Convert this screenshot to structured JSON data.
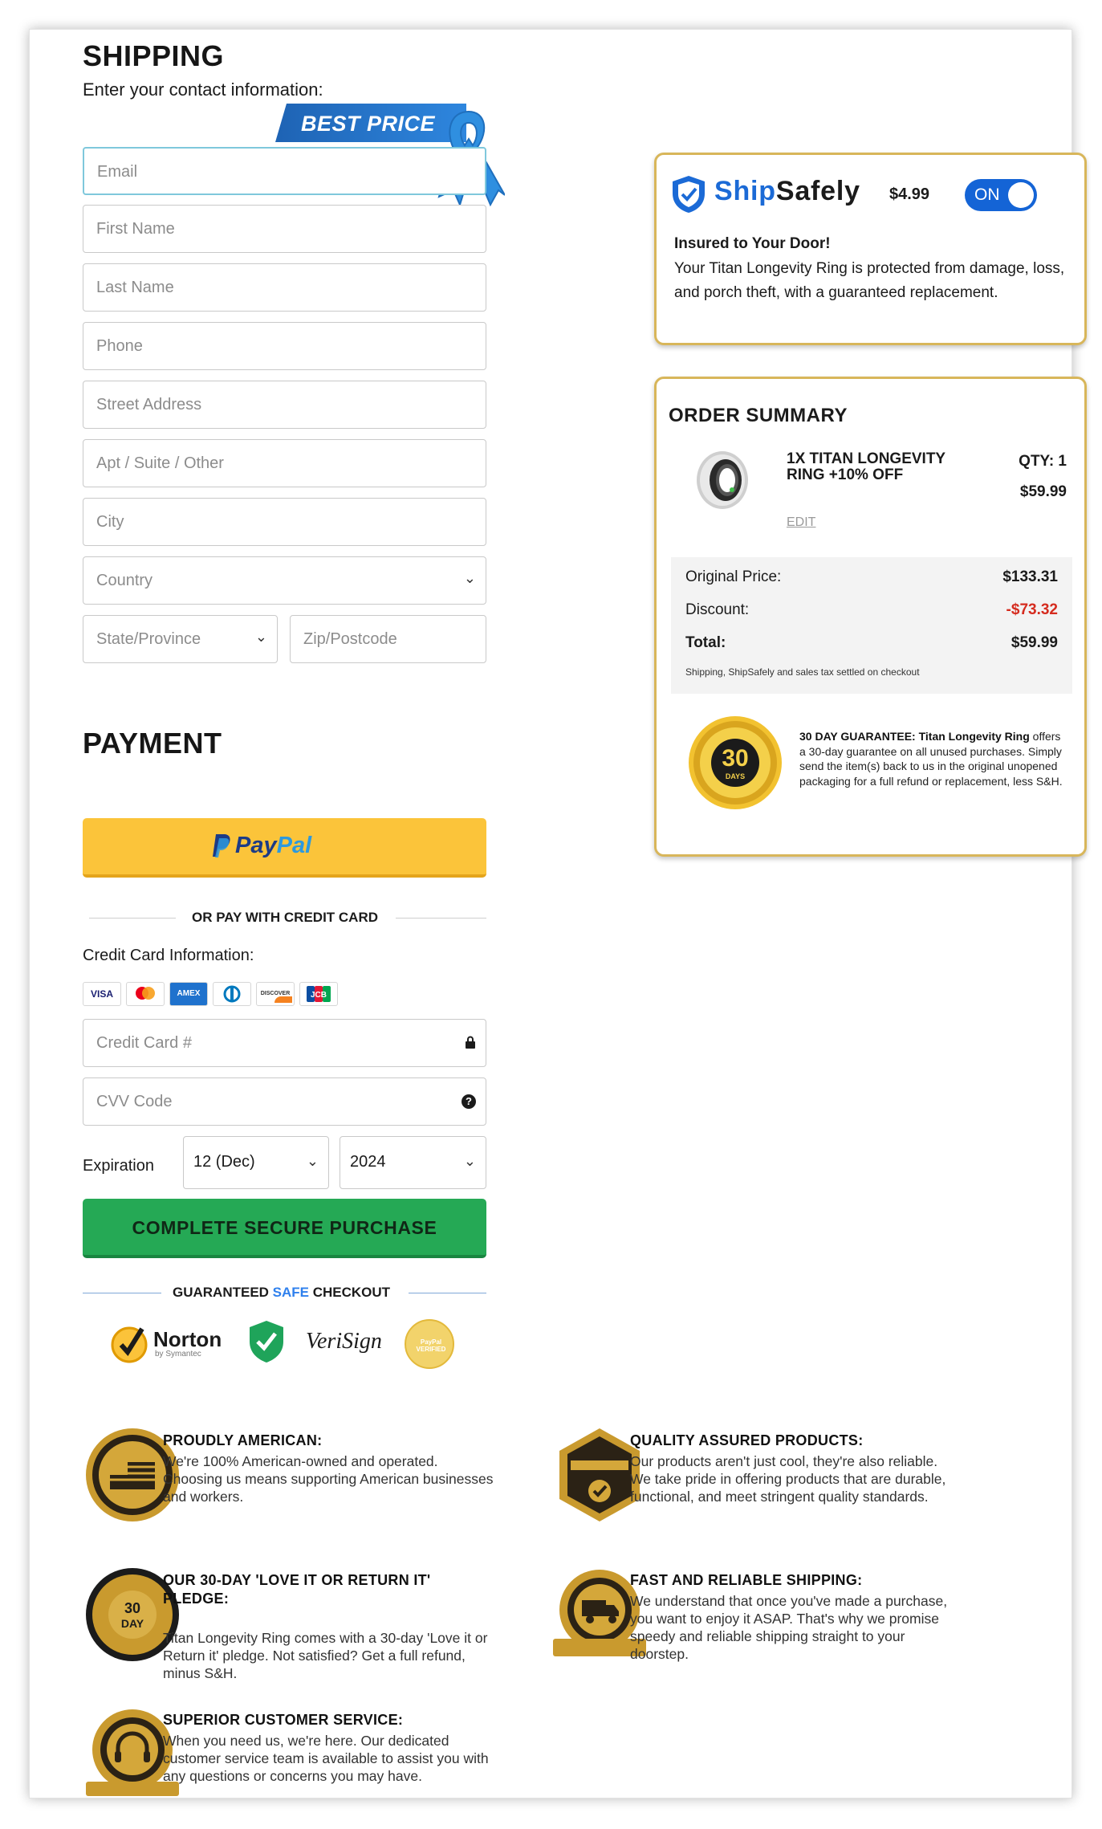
{
  "shipping": {
    "title": "SHIPPING",
    "subtitle": "Enter your contact information:",
    "best_price": "BEST PRICE",
    "fields": {
      "email": "Email",
      "first_name": "First Name",
      "last_name": "Last Name",
      "phone": "Phone",
      "street": "Street Address",
      "apt": "Apt / Suite / Other",
      "city": "City",
      "country": "Country",
      "state": "State/Province",
      "zip": "Zip/Postcode"
    }
  },
  "payment": {
    "title": "PAYMENT",
    "paypal_a": "Pay",
    "paypal_b": "Pal",
    "or_label": "OR PAY WITH CREDIT CARD",
    "cc_info_label": "Credit Card Information:",
    "cards": [
      "VISA",
      "mastercard",
      "AMEX",
      "diners",
      "DISCOVER",
      "JCB"
    ],
    "card_number_placeholder": "Credit Card #",
    "cvv_placeholder": "CVV Code",
    "expiration_label": "Expiration",
    "exp_month": "12 (Dec)",
    "exp_year": "2024",
    "submit_label": "COMPLETE SECURE PURCHASE",
    "guaranteed_a": "GUARANTEED ",
    "guaranteed_b": "SAFE",
    "guaranteed_c": " CHECKOUT",
    "trust_badges": [
      "Norton",
      "by Symantec",
      "VeriSign",
      "PayPal VERIFIED"
    ]
  },
  "shipsafely": {
    "name_a": "Ship",
    "name_b": "Safely",
    "price": "$4.99",
    "toggle": "ON",
    "heading": "Insured to Your Door!",
    "body": "Your Titan Longevity Ring is protected from damage, loss, and porch theft, with a guaranteed replacement."
  },
  "order": {
    "title": "ORDER SUMMARY",
    "product_name": "1X TITAN LONGEVITY RING +10% OFF",
    "qty": "QTY: 1",
    "price": "$59.99",
    "edit": "EDIT",
    "original_label": "Original Price:",
    "original_value": "$133.31",
    "discount_label": "Discount:",
    "discount_value": "-$73.32",
    "total_label": "Total:",
    "total_value": "$59.99",
    "note": "Shipping, ShipSafely and sales tax settled on checkout",
    "guarantee_title": "30 DAY GUARANTEE:",
    "guarantee_product": " Titan Longevity Ring",
    "guarantee_text": " offers a 30-day guarantee on all unused purchases. Simply send the item(s) back to us in the original unopened packaging for a full refund or replacement, less S&H.",
    "seal_big": "30",
    "seal_small": "DAYS"
  },
  "features": [
    {
      "title": "PROUDLY AMERICAN:",
      "text": "We're 100% American-owned and operated. Choosing us means supporting American businesses and workers."
    },
    {
      "title": "QUALITY ASSURED PRODUCTS:",
      "text": "Our products aren't just cool, they're also reliable. We take pride in offering products that are durable, functional, and meet stringent quality standards."
    },
    {
      "title": "OUR 30-DAY 'LOVE IT OR RETURN IT' PLEDGE:",
      "text": "Titan Longevity Ring comes with a 30-day 'Love it or Return it' pledge. Not satisfied? Get a full refund, minus S&H."
    },
    {
      "title": "FAST AND RELIABLE SHIPPING:",
      "text": "We understand that once you've made a purchase, you want to enjoy it ASAP. That's why we promise speedy and reliable shipping straight to your doorstep."
    },
    {
      "title": "SUPERIOR CUSTOMER SERVICE:",
      "text": "When you need us, we're here. Our dedicated customer service team is available to assist you with any questions or concerns you may have."
    }
  ],
  "colors": {
    "paypal_button": "#fbc43a",
    "submit_button": "#25a955",
    "ship_accent": "#1b6ad6",
    "box_border": "#d8b65a",
    "discount": "#d52b1e"
  }
}
